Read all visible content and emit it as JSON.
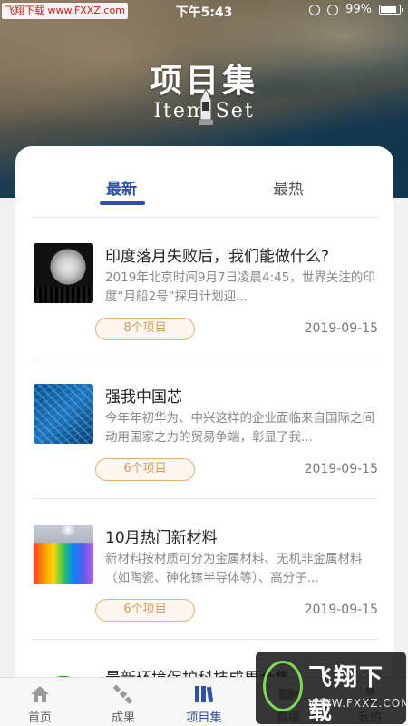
{
  "status_bar": {
    "watermark": "飞翔下载 www.FXXZ.com",
    "time": "下午5:43",
    "battery_percent": "99%",
    "battery_level": 0.99
  },
  "hero": {
    "title": "项目集",
    "subtitle": "Item Set"
  },
  "tabs": [
    {
      "label": "最新",
      "active": true
    },
    {
      "label": "最热",
      "active": false
    }
  ],
  "items": [
    {
      "title": "印度落月失败后，我们能做什么?",
      "desc": "2019年北京时间9月7日凌晨4:45，世界关注的印度“月船2号”探月计划迎...",
      "count": "8个项目",
      "date": "2019-09-15",
      "thumb": "moon-thumbnail"
    },
    {
      "title": "强我中国芯",
      "desc": "今年年初华为、中兴这样的企业面临来自国际之间动用国家之力的贸易争端，彰显了我...",
      "count": "6个项目",
      "date": "2019-09-15",
      "thumb": "chip-thumbnail"
    },
    {
      "title": "10月热门新材料",
      "desc": "新材料按材质可分为金属材料、无机非金属材料（如陶瓷、砷化镓半导体等）、高分子...",
      "count": "6个项目",
      "date": "2019-09-15",
      "thumb": "materials-thumbnail"
    },
    {
      "title": "最新环境保护科技成果合集",
      "thumb": "environment-thumbnail"
    }
  ],
  "bottom_nav": [
    {
      "label": "首页",
      "icon": "home-icon"
    },
    {
      "label": "成果",
      "icon": "satellite-icon"
    },
    {
      "label": "项目集",
      "icon": "books-icon",
      "active": true
    },
    {
      "label": "直播",
      "icon": "live-icon"
    },
    {
      "label": "我的",
      "icon": "profile-icon"
    }
  ],
  "watermark": {
    "text": "飞翔下载",
    "url": "WWW.FXXZ.COM"
  },
  "colors": {
    "accent": "#2f4fa8",
    "pill_border": "#e3b078",
    "pill_text": "#d39a5f"
  }
}
